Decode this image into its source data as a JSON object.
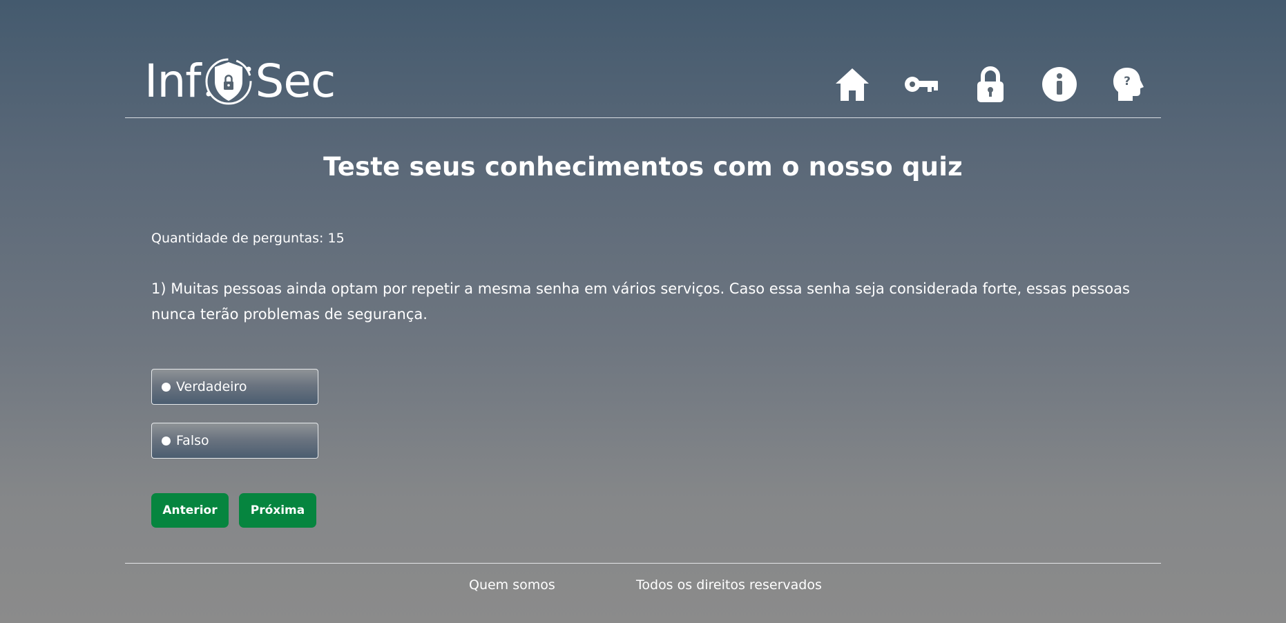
{
  "header": {
    "logo": {
      "text_left": "Inf",
      "text_right": "Sec",
      "icon": "shield-lock-icon"
    },
    "nav": [
      {
        "name": "home",
        "icon": "home-icon"
      },
      {
        "name": "key",
        "icon": "key-icon"
      },
      {
        "name": "lock",
        "icon": "lock-icon"
      },
      {
        "name": "info",
        "icon": "info-icon"
      },
      {
        "name": "quiz",
        "icon": "head-question-icon"
      }
    ]
  },
  "main": {
    "title": "Teste seus conhecimentos com o nosso quiz",
    "question_count": "Quantidade de perguntas: 15",
    "question": "1) Muitas pessoas ainda optam por repetir a mesma senha em vários serviços. Caso essa senha seja considerada forte, essas pessoas nunca terão problemas de segurança.",
    "options": [
      {
        "label": "Verdadeiro"
      },
      {
        "label": "Falso"
      }
    ],
    "buttons": {
      "prev_label": "Anterior",
      "next_label": "Próxima"
    }
  },
  "footer": {
    "about_label": "Quem somos",
    "rights_label": "Todos os direitos reservados"
  },
  "colors": {
    "accent_green": "#06853f",
    "text": "#ffffff",
    "bg_top": "#445a6e",
    "bg_bottom": "#8b8b8b"
  }
}
